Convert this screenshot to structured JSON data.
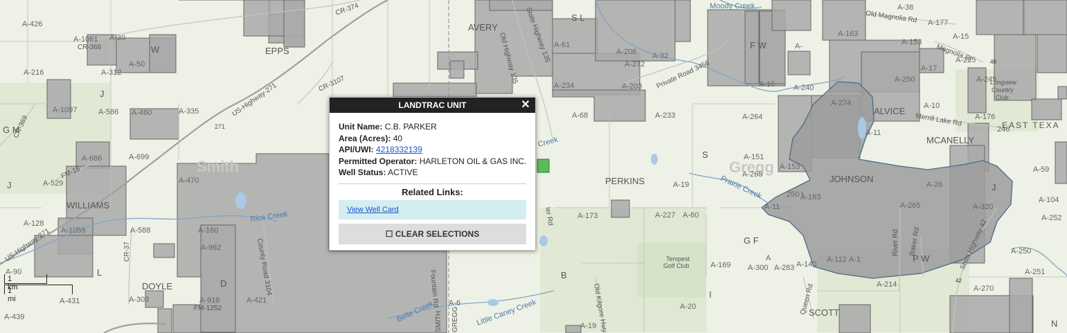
{
  "popup": {
    "title": "LANDTRAC UNIT",
    "close_glyph": "✕",
    "fields": [
      {
        "label": "Unit Name:",
        "value": "C.B. PARKER"
      },
      {
        "label": "Area (Acres):",
        "value": "40"
      },
      {
        "label": "API/UWI:",
        "value": "4218332139",
        "is_link": true
      },
      {
        "label": "Permitted Operator:",
        "value": "HARLETON OIL & GAS INC."
      },
      {
        "label": "Well Status:",
        "value": "ACTIVE"
      }
    ],
    "related_links_title": "Related Links:",
    "view_well_card": "View Well Card",
    "clear_selections": "☐ CLEAR SELECTIONS"
  },
  "scale": {
    "km": "1 km",
    "mi": "1 mi"
  },
  "map_labels": {
    "counties": [
      "Smith",
      "Gregg",
      "EAST TEXA"
    ],
    "communities": [
      "AVERY",
      "EPPS",
      "WILLIAMS",
      "DOYLE",
      "PERKINS",
      "ALVICE",
      "MCANELLY",
      "JOHNSON",
      "Longview Country Club",
      "Tempest Golf Club"
    ],
    "roads": [
      "CR-374",
      "CR-366",
      "CR-3107",
      "US-Highway-271",
      "271",
      "CR-369",
      "FM-16",
      "US-Highway-271",
      "CR-37",
      "County Road 3104",
      "FM-1252",
      "Old Highway 135",
      "State Highway 135",
      "Private Road 3456",
      "Old Magnolia Rd",
      "Merrill Lake Rd",
      "River Rd",
      "Baker Rd",
      "State Highway 42",
      "42",
      "Queen Rd",
      "Old Kilgore Hwy",
      "Fountain Rd",
      "Ler Rd"
    ],
    "water": [
      "Moody Creek",
      "Rice Creek",
      "Prairie Creek",
      "Belle Creek",
      "Little Caney Creek",
      "Creek"
    ],
    "abstracts": [
      "A-426",
      "A-1061",
      "A-39",
      "A-50",
      "A-216",
      "A-312",
      "A-1097",
      "A-586",
      "A-460",
      "A-335",
      "A-699",
      "A-686",
      "A-529",
      "A-470",
      "A-128",
      "A-1059",
      "A-588",
      "A-160",
      "A-962",
      "A-90",
      "A-431",
      "A-303",
      "A-918",
      "A-421",
      "A-439",
      "A-61",
      "A-206",
      "A-32",
      "A-272",
      "A-234",
      "A-203",
      "A-68",
      "A-233",
      "A-264",
      "A-151",
      "A-19",
      "A-173",
      "A-227",
      "A-60",
      "A-169",
      "A-300",
      "A-283",
      "A-20",
      "A-38",
      "A-163",
      "A-177",
      "A-153",
      "A-225",
      "A-250",
      "A-274",
      "A-11",
      "A-10",
      "A-176",
      "A-265",
      "A-59",
      "A-104",
      "A-252",
      "A-250",
      "A-251",
      "A-214",
      "A-270",
      "A-140",
      "A-112",
      "A-183",
      "A-16",
      "A-6",
      "A-19"
    ],
    "survey_letters": [
      "S L",
      "F W",
      "W",
      "J",
      "G M",
      "J",
      "L",
      "S",
      "G F",
      "B",
      "I",
      "P W",
      "N",
      "J",
      "SMITH",
      "GREGG",
      "SCOTT"
    ]
  }
}
